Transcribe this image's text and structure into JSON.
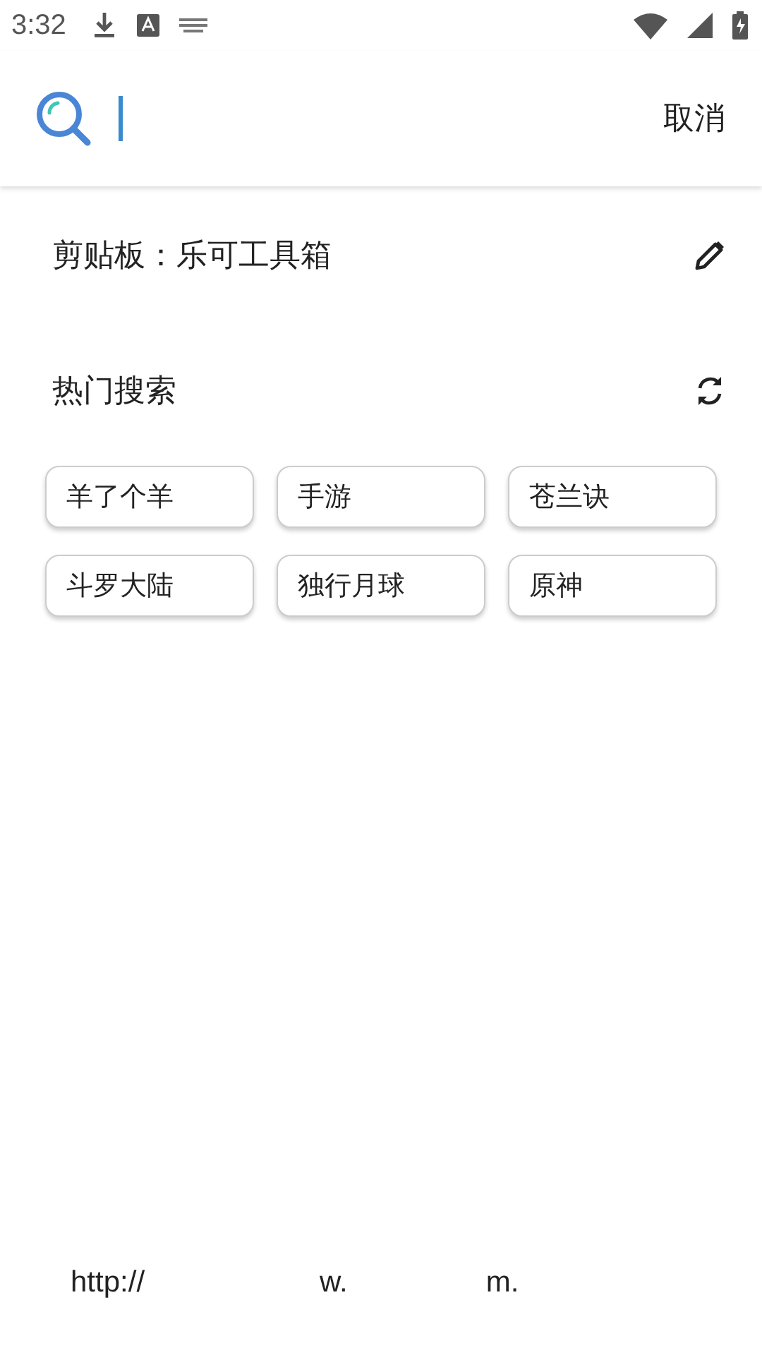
{
  "status_bar": {
    "time": "3:32"
  },
  "search": {
    "cancel": "取消"
  },
  "clipboard": {
    "text": "剪贴板：乐可工具箱"
  },
  "hot": {
    "title": "热门搜索",
    "tags": [
      "羊了个羊",
      "手游",
      "苍兰诀",
      "斗罗大陆",
      "独行月球",
      "原神"
    ]
  },
  "footer": [
    "http://",
    "w.",
    "m."
  ]
}
